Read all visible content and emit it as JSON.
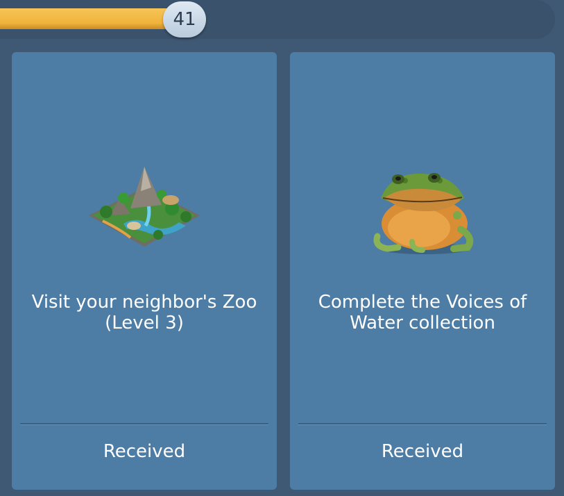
{
  "progress": {
    "level": "41",
    "fraction": 0.33
  },
  "cards": [
    {
      "image": "zoo-island-icon",
      "text": "Visit your neighbor's Zoo (Level 3)",
      "status": "Received"
    },
    {
      "image": "frog-icon",
      "text": "Complete the Voices of Water collection",
      "status": "Received"
    }
  ]
}
